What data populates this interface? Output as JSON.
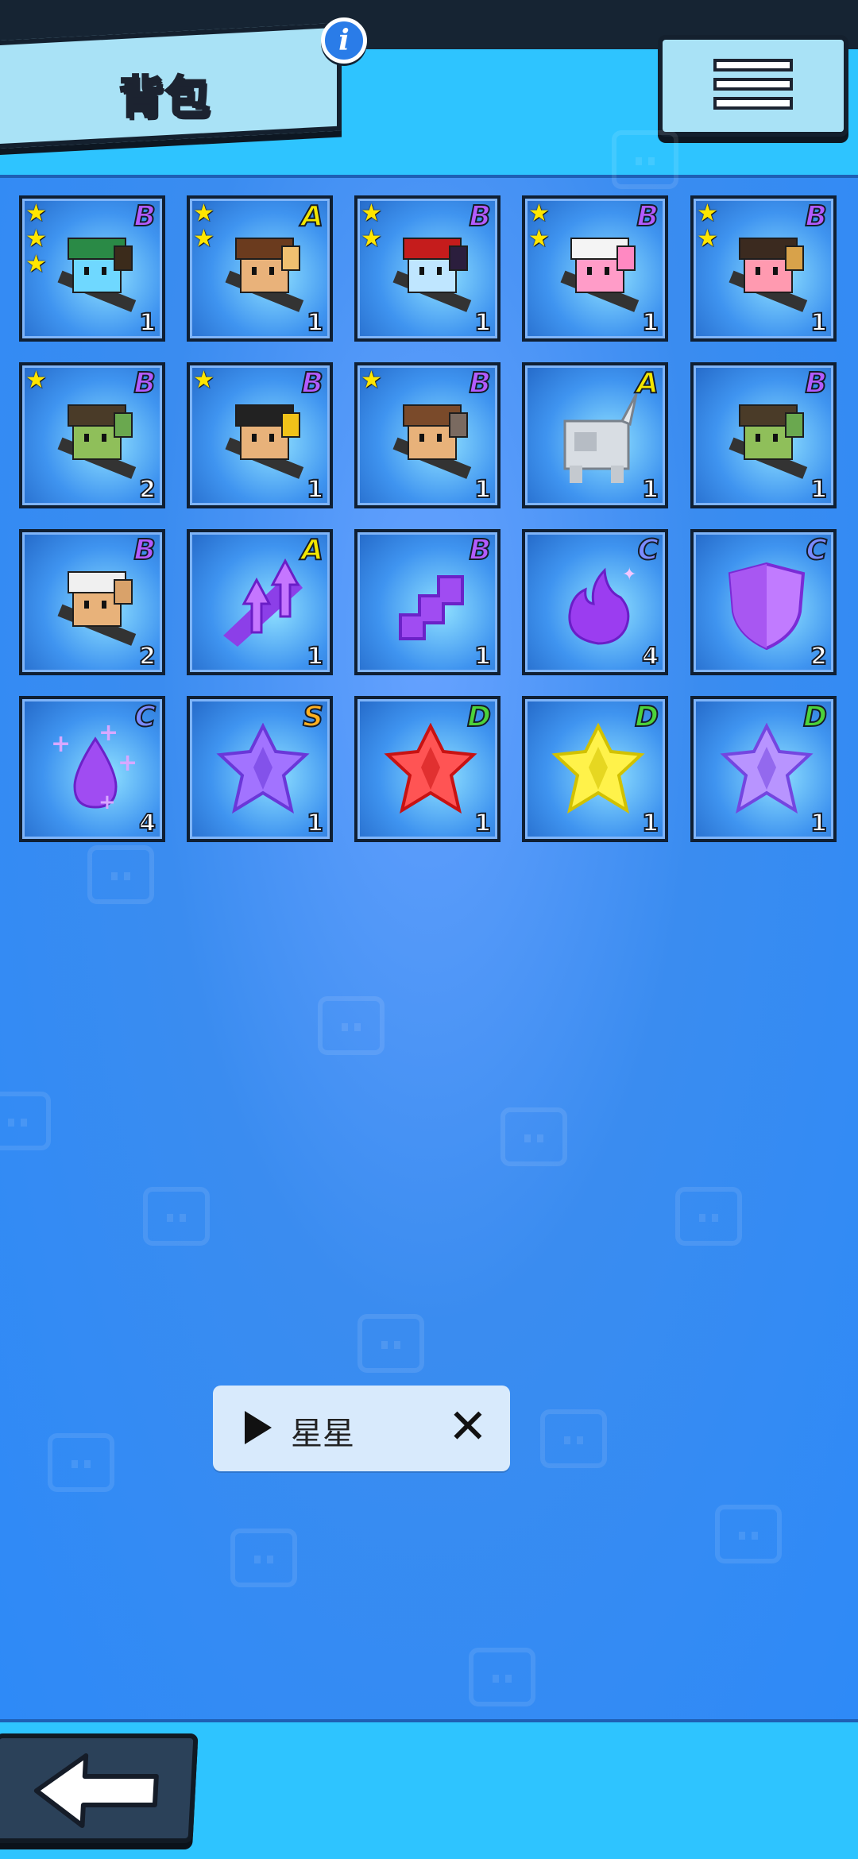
{
  "header": {
    "title": "背包",
    "info_label": "i",
    "menu_icon": "hamburger-menu-icon"
  },
  "colors": {
    "S": "#ffb020",
    "A": "#f3e600",
    "B": "#b35bff",
    "C": "#7b8bff",
    "D": "#4cd23a"
  },
  "items": [
    {
      "name": "green-helmet-gunner",
      "stars": 3,
      "grade": "B",
      "count": "1"
    },
    {
      "name": "brown-hair-swordsman",
      "stars": 2,
      "grade": "A",
      "count": "1"
    },
    {
      "name": "red-hair-mage",
      "stars": 2,
      "grade": "B",
      "count": "1"
    },
    {
      "name": "pink-cat-swordsman",
      "stars": 2,
      "grade": "B",
      "count": "1"
    },
    {
      "name": "gold-antler-warrior",
      "stars": 2,
      "grade": "B",
      "count": "1"
    },
    {
      "name": "green-face-hat-scout",
      "stars": 1,
      "grade": "B",
      "count": "2"
    },
    {
      "name": "yellow-helmet-spearman",
      "stars": 1,
      "grade": "B",
      "count": "1"
    },
    {
      "name": "horned-axe-warrior",
      "stars": 1,
      "grade": "B",
      "count": "1"
    },
    {
      "name": "white-unicorn-mech",
      "stars": 0,
      "grade": "A",
      "count": "1"
    },
    {
      "name": "green-face-hat-scout-2",
      "stars": 0,
      "grade": "B",
      "count": "1"
    },
    {
      "name": "winged-helmet-swordsman",
      "stars": 0,
      "grade": "B",
      "count": "2"
    },
    {
      "name": "purple-double-arrow",
      "stars": 0,
      "grade": "A",
      "count": "1"
    },
    {
      "name": "purple-staircase",
      "stars": 0,
      "grade": "B",
      "count": "1"
    },
    {
      "name": "purple-flame",
      "stars": 0,
      "grade": "C",
      "count": "4"
    },
    {
      "name": "purple-shield",
      "stars": 0,
      "grade": "C",
      "count": "2"
    },
    {
      "name": "purple-droplet-plus",
      "stars": 0,
      "grade": "C",
      "count": "4"
    },
    {
      "name": "purple-star-gem",
      "stars": 0,
      "grade": "S",
      "count": "1"
    },
    {
      "name": "red-star-gem",
      "stars": 0,
      "grade": "D",
      "count": "1"
    },
    {
      "name": "yellow-star-gem",
      "stars": 0,
      "grade": "D",
      "count": "1"
    },
    {
      "name": "violet-star-gem",
      "stars": 0,
      "grade": "D",
      "count": "1"
    }
  ],
  "filter_chip": {
    "label": "星星"
  },
  "back_icon": "back-arrow-icon"
}
